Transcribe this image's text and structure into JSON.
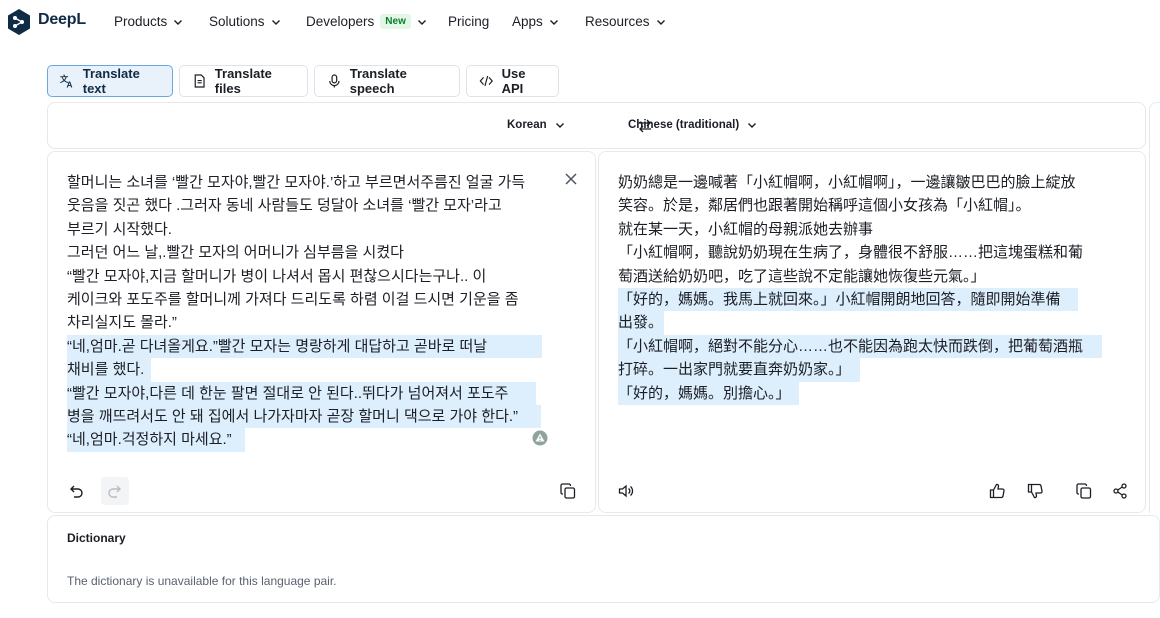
{
  "nav": {
    "brand": "DeepL",
    "items": [
      {
        "label": "Products"
      },
      {
        "label": "Solutions"
      },
      {
        "label": "Developers",
        "badge": "New"
      },
      {
        "label": "Pricing"
      },
      {
        "label": "Apps"
      },
      {
        "label": "Resources"
      }
    ]
  },
  "tabs": [
    {
      "label": "Translate text",
      "icon": "translate-icon",
      "active": true
    },
    {
      "label": "Translate files",
      "icon": "file-icon"
    },
    {
      "label": "Translate speech",
      "icon": "microphone-icon"
    },
    {
      "label": "Use API",
      "icon": "code-icon"
    }
  ],
  "languages": {
    "source": "Korean",
    "target": "Chinese (traditional)"
  },
  "source_text": {
    "lines": [
      "할머니는 소녀를 ‘빨간 모자야,빨간 모자야.’하고 부르면서주름진 얼굴 가득",
      "웃음을 짓곤 했다 .그러자 동네 사람들도 덩달아 소녀를 ‘빨간 모자’라고",
      "부르기 시작했다.",
      "그러던 어느 날,.빨간 모자의 어머니가 심부름을 시켰다",
      "“빨간 모자야,지금 할머니가 병이 나셔서 몹시 편찮으시다는구나.. 이",
      "케이크와 포도주를 할머니께 가져다 드리도록 하렴 이걸 드시면 기운을 좀",
      "차리실지도 몰라.”",
      "“네,엄마.곧 다녀올게요.”빨간 모자는 명랑하게 대답하고 곧바로 떠날",
      "채비를 했다.",
      "“빨간 모자야,다른 데 한눈 팔면 절대로 안 된다..뛰다가 넘어져서 포도주",
      "병을 깨뜨려서도 안 돼 집에서 나가자마자 곧장 할머니 댁으로 가야 한다.”",
      "“네,엄마.걱정하지 마세요.”"
    ]
  },
  "target_text": {
    "lines": [
      "奶奶總是一邊喊著「小紅帽啊，小紅帽啊」，一邊讓皺巴巴的臉上綻放",
      "笑容。於是，鄰居們也跟著開始稱呼這個小女孩為「小紅帽」。",
      "就在某一天，小紅帽的母親派她去辦事",
      "「小紅帽啊，聽說奶奶現在生病了，身體很不舒服……把這塊蛋糕和葡",
      "萄酒送給奶奶吧，吃了這些說不定能讓她恢復些元氣。」",
      "「好的，媽媽。我馬上就回來。」小紅帽開朗地回答，隨即開始準備",
      "出發。",
      "「小紅帽啊，絕對不能分心……也不能因為跑太快而跌倒，把葡萄酒瓶",
      "打碎。一出家門就要直奔奶奶家。」",
      "「好的，媽媽。別擔心。」"
    ]
  },
  "dictionary": {
    "title": "Dictionary",
    "message": "The dictionary is unavailable for this language pair."
  },
  "colors": {
    "brand": "#0f2b46",
    "highlight": "#ddeefc",
    "active_tab_bg": "#e9f2fb",
    "new_badge_bg": "#e3f7e6"
  }
}
